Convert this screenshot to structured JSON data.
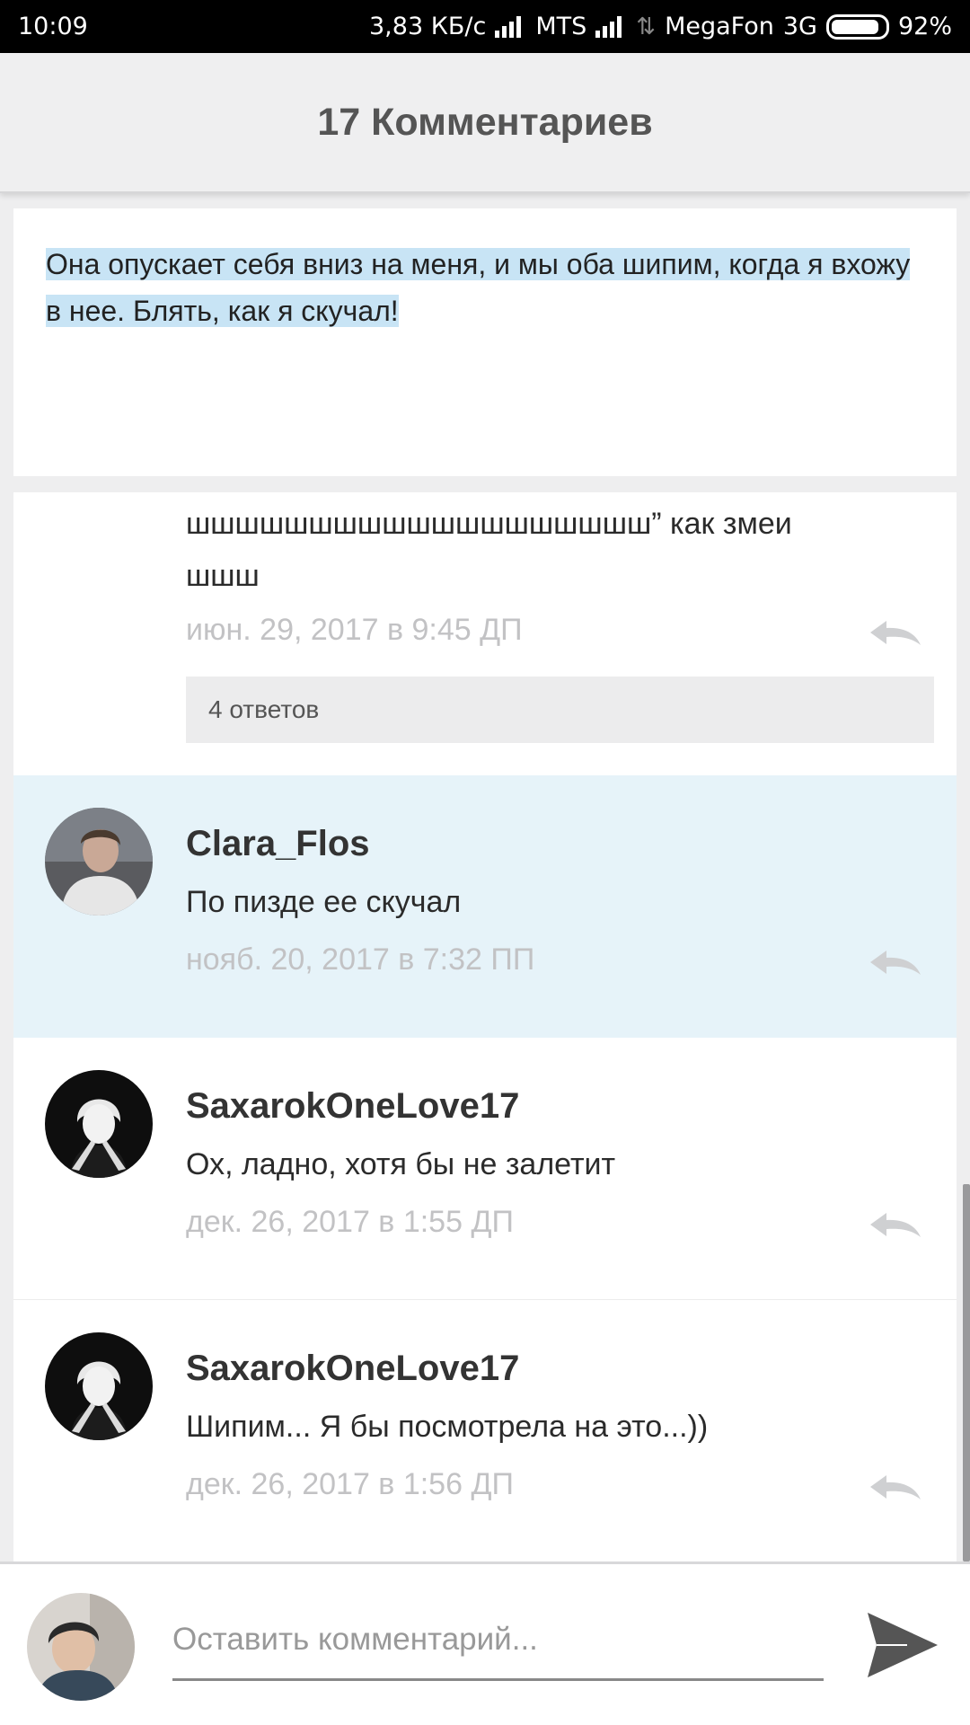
{
  "status_bar": {
    "time": "10:09",
    "speed": "3,83 КБ/с",
    "carrier1": "MTS",
    "carrier2": "MegaFon",
    "network": "3G",
    "battery": "92%"
  },
  "header": {
    "title": "17 Комментариев"
  },
  "quote": {
    "text": "Она опускает себя вниз на меня, и мы оба шипим, когда я вхожу в нее. Блять, как я скучал!"
  },
  "previous_comment": {
    "text_fragment": "шшшшшшшшшшшшшшшшшшш” как змеи шшш",
    "timestamp": "июн. 29, 2017 в 9:45 ДП",
    "replies_label": "4 ответов"
  },
  "comments": [
    {
      "author": "Clara_Flos",
      "text": "По пизде ее скучал",
      "timestamp": "нояб. 20, 2017 в 7:32 ПП",
      "highlighted": true,
      "avatar": "avatar-clara"
    },
    {
      "author": "SaxarokOneLove17",
      "text": "Ох, ладно, хотя бы не залетит",
      "timestamp": "дек. 26, 2017 в 1:55 ДП",
      "highlighted": false,
      "avatar": "avatar-saxarok"
    },
    {
      "author": "SaxarokOneLove17",
      "text": "Шипим... Я бы посмотрела на это...))",
      "timestamp": "дек. 26, 2017 в 1:56 ДП",
      "highlighted": false,
      "avatar": "avatar-saxarok"
    }
  ],
  "composer": {
    "placeholder": "Оставить комментарий..."
  },
  "colors": {
    "highlight": "#e6f3f9",
    "selection": "#c8e4f5",
    "timestamp": "#c2c2c4"
  },
  "icons": {
    "reply": "reply-arrow-icon",
    "send": "send-icon"
  }
}
